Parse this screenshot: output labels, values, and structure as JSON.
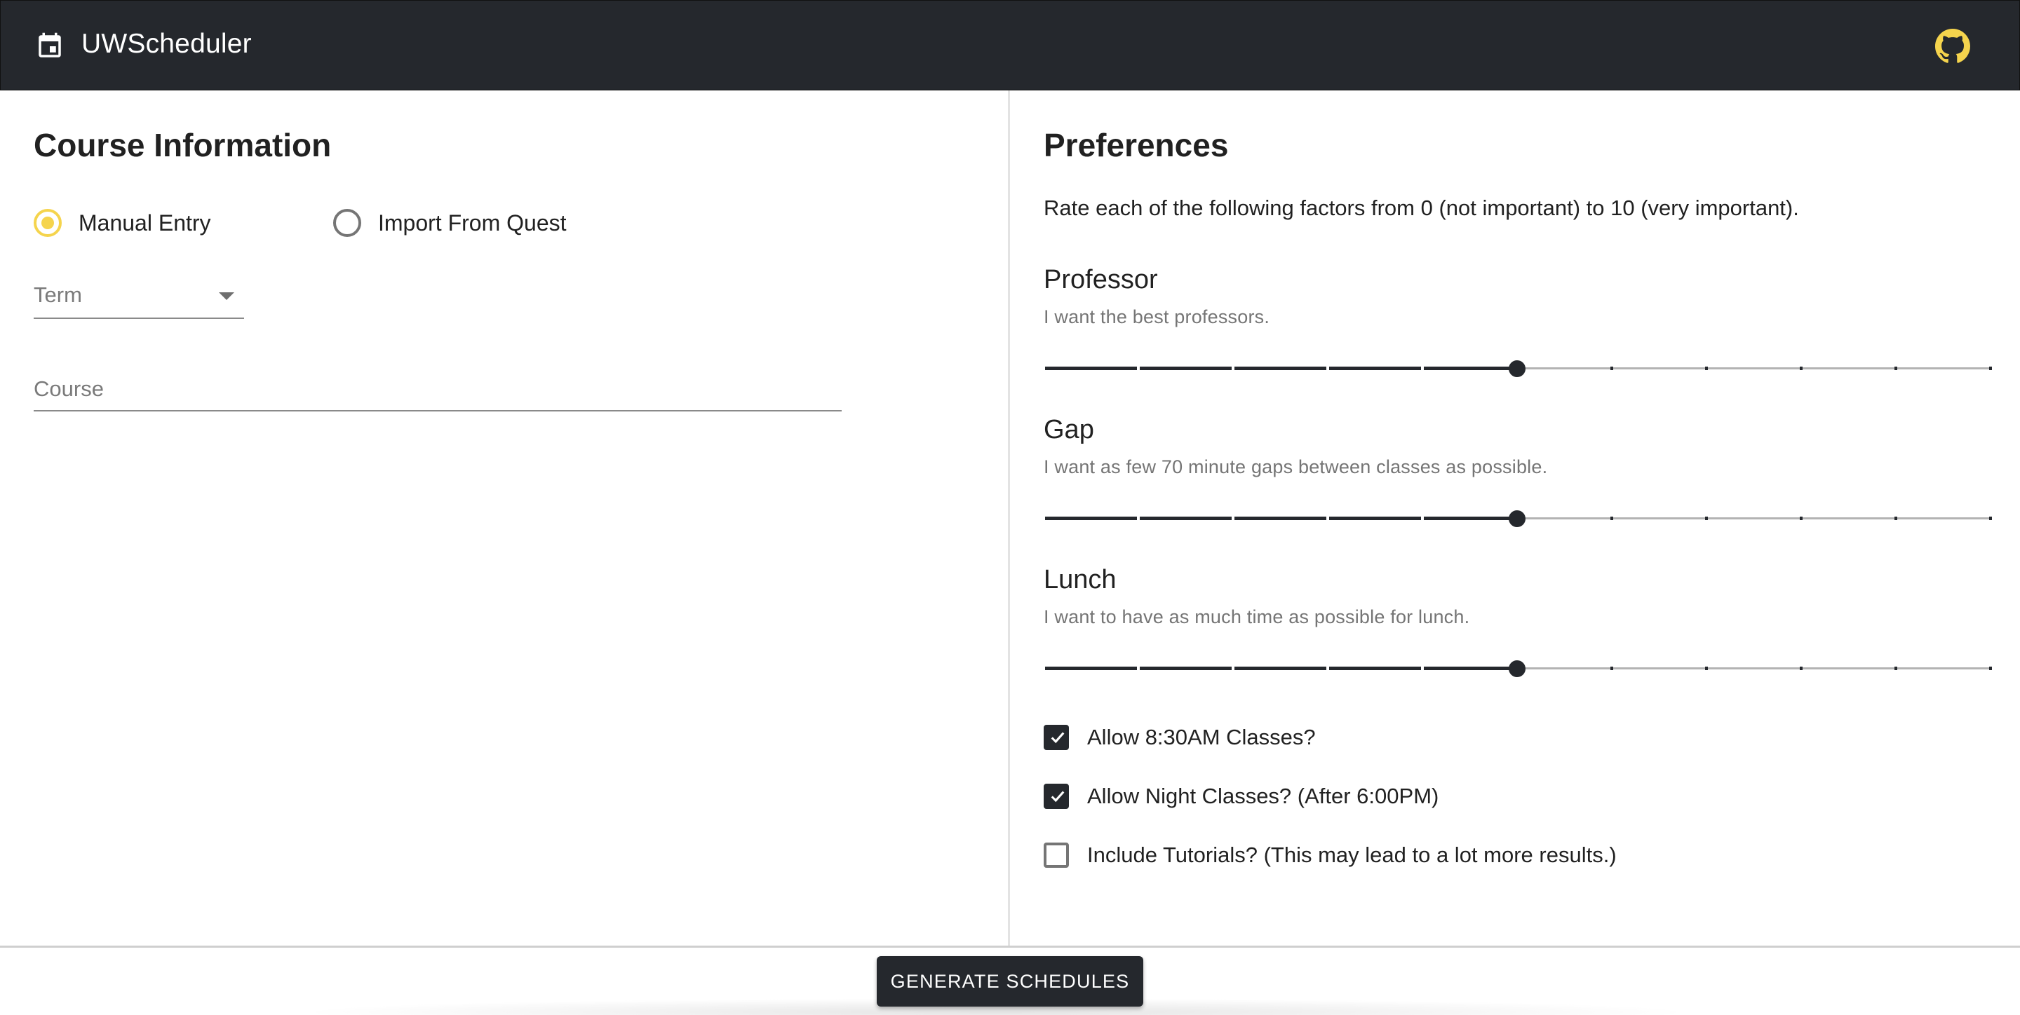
{
  "app": {
    "title": "UWScheduler",
    "calendar_icon": "calendar-icon",
    "github_icon": "github-icon"
  },
  "course_info": {
    "title": "Course Information",
    "entry_mode": {
      "options": [
        {
          "label": "Manual Entry",
          "selected": true
        },
        {
          "label": "Import From Quest",
          "selected": false
        }
      ]
    },
    "term": {
      "placeholder": "Term",
      "value": ""
    },
    "course": {
      "placeholder": "Course",
      "value": ""
    }
  },
  "preferences": {
    "title": "Preferences",
    "description": "Rate each of the following factors from 0 (not important) to 10 (very important).",
    "sliders": [
      {
        "name": "Professor",
        "subtitle": "I want the best professors.",
        "value": 5,
        "min": 0,
        "max": 10
      },
      {
        "name": "Gap",
        "subtitle": "I want as few 70 minute gaps between classes as possible.",
        "value": 5,
        "min": 0,
        "max": 10
      },
      {
        "name": "Lunch",
        "subtitle": "I want to have as much time as possible for lunch.",
        "value": 5,
        "min": 0,
        "max": 10
      }
    ],
    "checkboxes": [
      {
        "label": "Allow 8:30AM Classes?",
        "checked": true
      },
      {
        "label": "Allow Night Classes? (After 6:00PM)",
        "checked": true
      },
      {
        "label": "Include Tutorials? (This may lead to a lot more results.)",
        "checked": false
      }
    ]
  },
  "footer": {
    "generate_label": "GENERATE SCHEDULES"
  },
  "colors": {
    "appbar": "#25282d",
    "accent": "#f5d44d",
    "slider": "#25282d",
    "rail": "#b3b3b3"
  }
}
